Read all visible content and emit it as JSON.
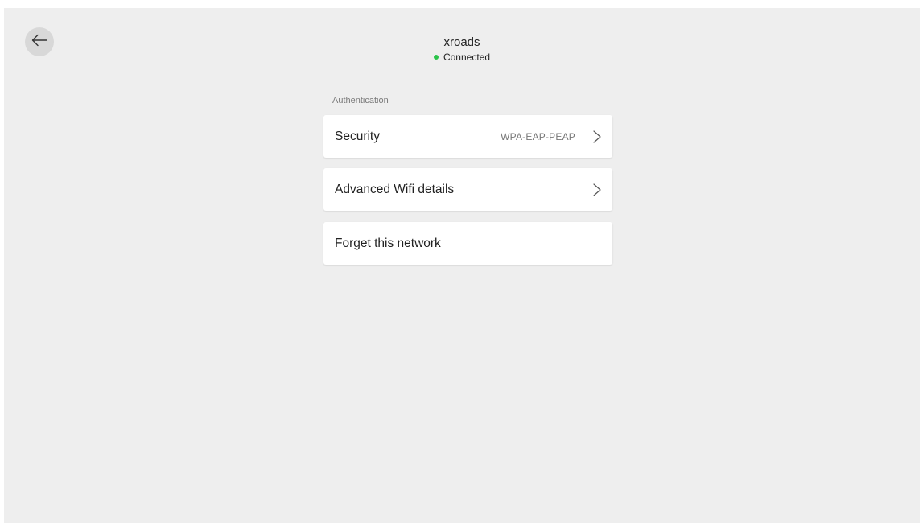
{
  "header": {
    "network_name": "xroads",
    "status": "Connected",
    "status_color": "#2bc34a"
  },
  "back_icon": "arrow-left-icon",
  "section": {
    "label": "Authentication"
  },
  "rows": {
    "security": {
      "label": "Security",
      "value": "WPA-EAP-PEAP",
      "icon": "chevron-right-icon"
    },
    "advanced": {
      "label": "Advanced Wifi details",
      "icon": "chevron-right-icon"
    },
    "forget": {
      "label": "Forget this network"
    }
  }
}
